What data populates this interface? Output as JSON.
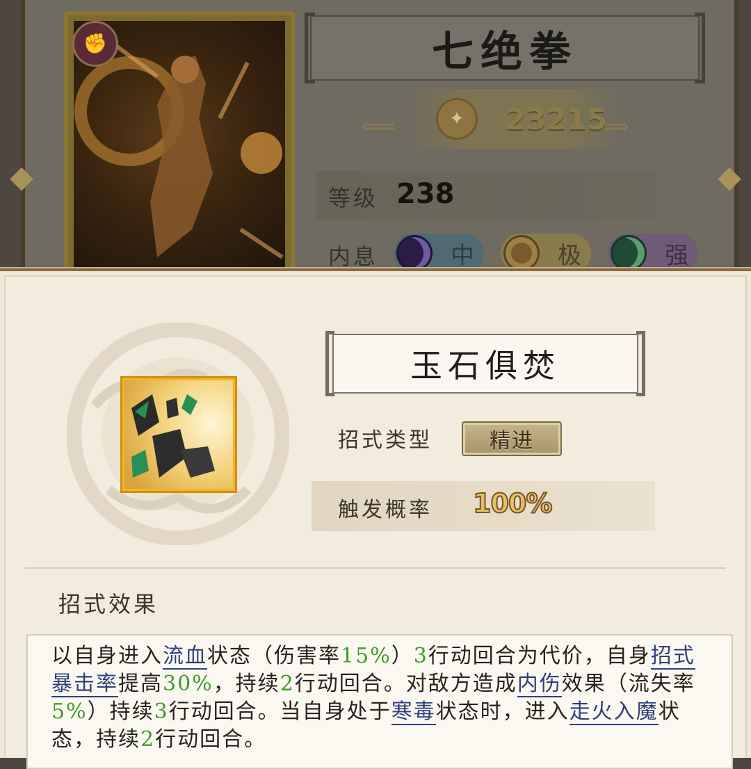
{
  "hero": {
    "name": "七绝拳",
    "power": "23215",
    "level_label": "等级",
    "level": "238",
    "neixi_label": "内息",
    "neixi": [
      {
        "text": "中",
        "color": "#4f6a72"
      },
      {
        "text": "极",
        "color": "#8a7b4c"
      },
      {
        "text": "强",
        "color": "#6f5a79"
      }
    ]
  },
  "skill": {
    "name": "玉石俱焚",
    "type_label": "招式类型",
    "type_value": "精进",
    "rate_label": "触发概率",
    "rate_value": "100%",
    "effect_title": "招式效果",
    "description": [
      {
        "t": "以自身进入"
      },
      {
        "t": "流血",
        "style": "kw"
      },
      {
        "t": "状态（伤害率"
      },
      {
        "t": "15%",
        "style": "g"
      },
      {
        "t": "）"
      },
      {
        "t": "3",
        "style": "g"
      },
      {
        "t": "行动回合为代价，自身"
      },
      {
        "t": "招式暴击率",
        "style": "kw"
      },
      {
        "t": "提高"
      },
      {
        "t": "30%",
        "style": "g"
      },
      {
        "t": "，持续"
      },
      {
        "t": "2",
        "style": "g"
      },
      {
        "t": "行动回合。对敌方造成"
      },
      {
        "t": "内伤",
        "style": "kw"
      },
      {
        "t": "效果（流失率"
      },
      {
        "t": "5%",
        "style": "g"
      },
      {
        "t": "）持续"
      },
      {
        "t": "3",
        "style": "g"
      },
      {
        "t": "行动回合。当自身处于"
      },
      {
        "t": "寒毒",
        "style": "kw"
      },
      {
        "t": "状态时，进入"
      },
      {
        "t": "走火入魔",
        "style": "kw"
      },
      {
        "t": "状态，持续"
      },
      {
        "t": "2",
        "style": "g"
      },
      {
        "t": "行动回合。"
      }
    ]
  },
  "icons": {
    "hero_badge": "fist-icon",
    "power": "power-icon",
    "skill": "jade-shatter-skill-icon",
    "nav_prev": "chevron-left-icon",
    "nav_next": "chevron-right-icon"
  },
  "colors": {
    "highlight_number": "#3e9a2b",
    "keyword_link": "#2f3f7a",
    "frame_gold": "#f3b526"
  }
}
